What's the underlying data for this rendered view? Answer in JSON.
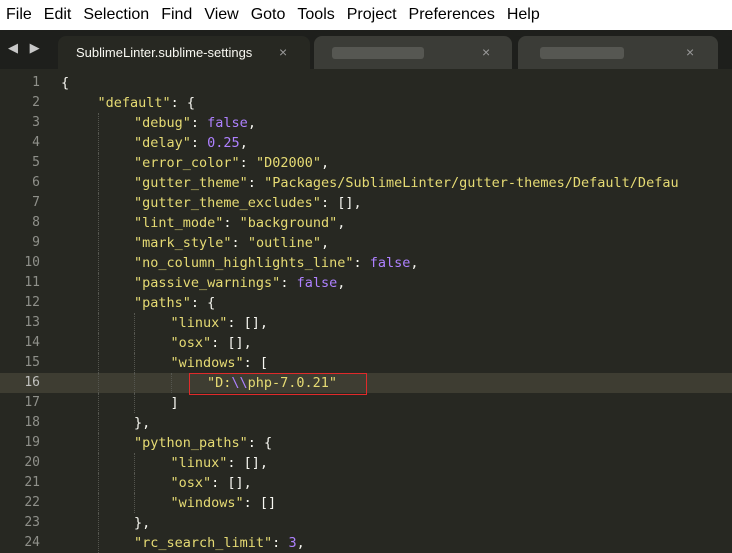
{
  "menu": [
    "File",
    "Edit",
    "Selection",
    "Find",
    "View",
    "Goto",
    "Tools",
    "Project",
    "Preferences",
    "Help"
  ],
  "tabs": {
    "nav_arrows": "◀ ▶",
    "active_label": "SublimeLinter.sublime-settings",
    "close_glyph": "×"
  },
  "editor": {
    "current_line": 16,
    "colors": {
      "background": "#272822",
      "string": "#e6db74",
      "literal": "#ae81ff",
      "text": "#f8f8f2",
      "gutter": "#8f908a"
    },
    "lines": [
      {
        "n": "1",
        "indent": 0,
        "tokens": [
          [
            "p",
            "{"
          ]
        ]
      },
      {
        "n": "2",
        "indent": 1,
        "tokens": [
          [
            "s",
            "\"default\""
          ],
          [
            "p",
            ": {"
          ]
        ]
      },
      {
        "n": "3",
        "indent": 2,
        "tokens": [
          [
            "s",
            "\"debug\""
          ],
          [
            "p",
            ": "
          ],
          [
            "l",
            "false"
          ],
          [
            "p",
            ","
          ]
        ]
      },
      {
        "n": "4",
        "indent": 2,
        "tokens": [
          [
            "s",
            "\"delay\""
          ],
          [
            "p",
            ": "
          ],
          [
            "l",
            "0.25"
          ],
          [
            "p",
            ","
          ]
        ]
      },
      {
        "n": "5",
        "indent": 2,
        "tokens": [
          [
            "s",
            "\"error_color\""
          ],
          [
            "p",
            ": "
          ],
          [
            "s",
            "\"D02000\""
          ],
          [
            "p",
            ","
          ]
        ]
      },
      {
        "n": "6",
        "indent": 2,
        "tokens": [
          [
            "s",
            "\"gutter_theme\""
          ],
          [
            "p",
            ": "
          ],
          [
            "s",
            "\"Packages/SublimeLinter/gutter-themes/Default/Defau"
          ]
        ]
      },
      {
        "n": "7",
        "indent": 2,
        "tokens": [
          [
            "s",
            "\"gutter_theme_excludes\""
          ],
          [
            "p",
            ": [],"
          ]
        ]
      },
      {
        "n": "8",
        "indent": 2,
        "tokens": [
          [
            "s",
            "\"lint_mode\""
          ],
          [
            "p",
            ": "
          ],
          [
            "s",
            "\"background\""
          ],
          [
            "p",
            ","
          ]
        ]
      },
      {
        "n": "9",
        "indent": 2,
        "tokens": [
          [
            "s",
            "\"mark_style\""
          ],
          [
            "p",
            ": "
          ],
          [
            "s",
            "\"outline\""
          ],
          [
            "p",
            ","
          ]
        ]
      },
      {
        "n": "10",
        "indent": 2,
        "tokens": [
          [
            "s",
            "\"no_column_highlights_line\""
          ],
          [
            "p",
            ": "
          ],
          [
            "l",
            "false"
          ],
          [
            "p",
            ","
          ]
        ]
      },
      {
        "n": "11",
        "indent": 2,
        "tokens": [
          [
            "s",
            "\"passive_warnings\""
          ],
          [
            "p",
            ": "
          ],
          [
            "l",
            "false"
          ],
          [
            "p",
            ","
          ]
        ]
      },
      {
        "n": "12",
        "indent": 2,
        "tokens": [
          [
            "s",
            "\"paths\""
          ],
          [
            "p",
            ": {"
          ]
        ]
      },
      {
        "n": "13",
        "indent": 3,
        "tokens": [
          [
            "s",
            "\"linux\""
          ],
          [
            "p",
            ": [],"
          ]
        ]
      },
      {
        "n": "14",
        "indent": 3,
        "tokens": [
          [
            "s",
            "\"osx\""
          ],
          [
            "p",
            ": [],"
          ]
        ]
      },
      {
        "n": "15",
        "indent": 3,
        "tokens": [
          [
            "s",
            "\"windows\""
          ],
          [
            "p",
            ": ["
          ]
        ]
      },
      {
        "n": "16",
        "indent": 4,
        "tokens": [
          [
            "s",
            "\"D:"
          ],
          [
            "l",
            "\\\\"
          ],
          [
            "s",
            "php-7.0.21\""
          ]
        ]
      },
      {
        "n": "17",
        "indent": 3,
        "tokens": [
          [
            "p",
            "]"
          ]
        ]
      },
      {
        "n": "18",
        "indent": 2,
        "tokens": [
          [
            "p",
            "},"
          ]
        ]
      },
      {
        "n": "19",
        "indent": 2,
        "tokens": [
          [
            "s",
            "\"python_paths\""
          ],
          [
            "p",
            ": {"
          ]
        ]
      },
      {
        "n": "20",
        "indent": 3,
        "tokens": [
          [
            "s",
            "\"linux\""
          ],
          [
            "p",
            ": [],"
          ]
        ]
      },
      {
        "n": "21",
        "indent": 3,
        "tokens": [
          [
            "s",
            "\"osx\""
          ],
          [
            "p",
            ": [],"
          ]
        ]
      },
      {
        "n": "22",
        "indent": 3,
        "tokens": [
          [
            "s",
            "\"windows\""
          ],
          [
            "p",
            ": []"
          ]
        ]
      },
      {
        "n": "23",
        "indent": 2,
        "tokens": [
          [
            "p",
            "},"
          ]
        ]
      },
      {
        "n": "24",
        "indent": 2,
        "tokens": [
          [
            "s",
            "\"rc_search_limit\""
          ],
          [
            "p",
            ": "
          ],
          [
            "l",
            "3"
          ],
          [
            "p",
            ","
          ]
        ]
      }
    ]
  }
}
